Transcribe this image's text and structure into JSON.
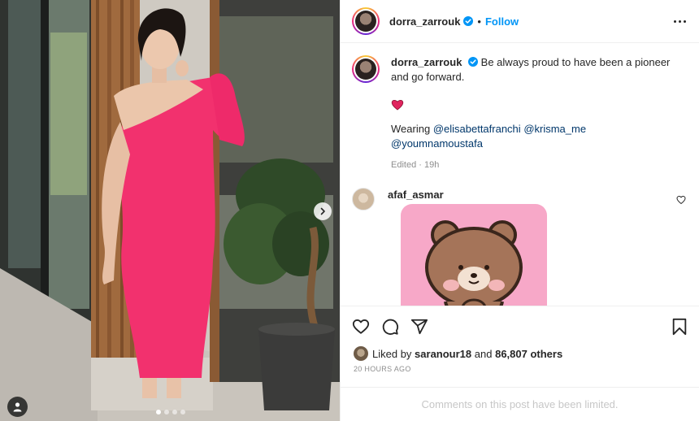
{
  "post": {
    "author": "dorra_zarrouk",
    "follow_label": "Follow",
    "separator": "•",
    "caption_text": "Be always proud to have been a pioneer and go forward.",
    "caption_emoji": "red-heart",
    "wearing_prefix": "Wearing",
    "mentions": [
      "@elisabettafranchi",
      "@krisma_me",
      "@youmnamoustafa"
    ],
    "edited_label": "Edited",
    "meta_separator": "·",
    "edited_age": "19h"
  },
  "comments": [
    {
      "user": "afaf_asmar",
      "content": "bear-sticker"
    }
  ],
  "likes": {
    "prefix": "Liked by",
    "user": "saranour18",
    "middle": "and",
    "count": "86,807 others"
  },
  "timestamp": "20 HOURS AGO",
  "comments_limited": "Comments on this post have been limited.",
  "carousel": {
    "slides": 4,
    "active": 1
  },
  "icons": {
    "verified": "verified-badge-icon",
    "more": "more-options-icon",
    "like": "heart-icon",
    "comment": "comment-icon",
    "share": "share-icon",
    "save": "bookmark-icon",
    "next": "chevron-right-icon",
    "tags": "user-tag-icon"
  },
  "colors": {
    "accent": "#0095f6",
    "mention": "#00376b",
    "muted": "#8e8e8e",
    "dress": "#f2316e"
  }
}
